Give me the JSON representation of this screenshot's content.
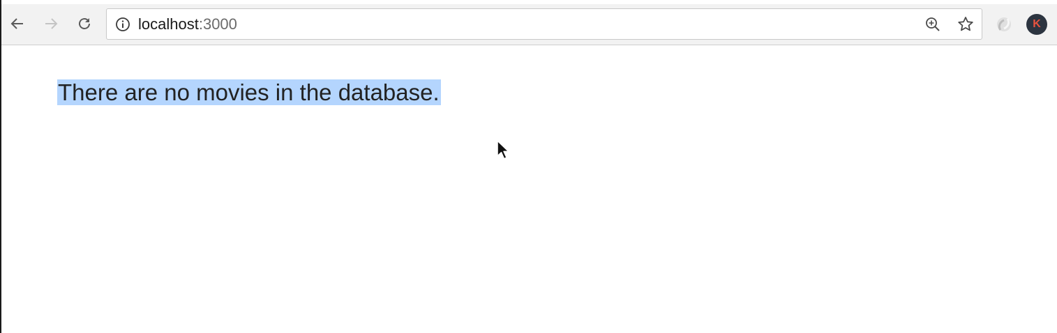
{
  "browser": {
    "url_host": "localhost",
    "url_port": ":3000",
    "avatar_letter": "K",
    "icons": {
      "back": "arrow-left-icon",
      "forward": "arrow-right-icon",
      "reload": "reload-icon",
      "info": "info-circle-icon",
      "zoom": "zoom-in-icon",
      "bookmark": "star-icon",
      "extension": "extension-icon",
      "cursor": "mouse-pointer-icon"
    }
  },
  "page": {
    "message": "There are no movies in the database."
  },
  "colors": {
    "selection": "#b4d5fe",
    "toolbar": "#f2f2f2",
    "avatar_bg": "#2c3440",
    "avatar_fg": "#e8533f"
  }
}
